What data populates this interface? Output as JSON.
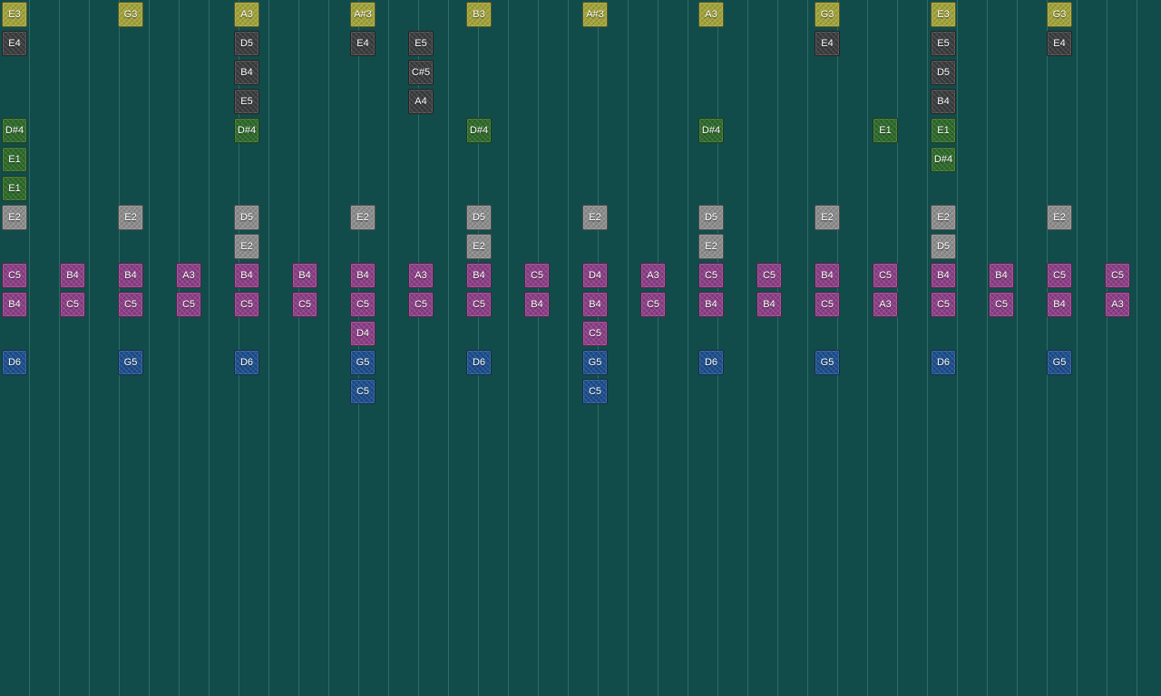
{
  "track_colors": {
    "yellow": "#a3a43a",
    "dark": "#3b3d3e",
    "green": "#2e6b2a",
    "gray": "#8e8e8e",
    "pink": "#8d3f87",
    "blue": "#1d4f8e"
  },
  "rows": [
    {
      "track": "yellow",
      "notes": [
        [
          "E3",
          0
        ],
        [
          "G3",
          4
        ],
        [
          "A3",
          8
        ],
        [
          "A#3",
          12
        ],
        [
          "B3",
          16
        ],
        [
          "A#3",
          20
        ],
        [
          "A3",
          24
        ],
        [
          "G3",
          28
        ],
        [
          "E3",
          32
        ],
        [
          "G3",
          36
        ]
      ]
    },
    {
      "track": "dark",
      "notes": [
        [
          "E4",
          0
        ],
        [
          "D5",
          8
        ],
        [
          "E4",
          12
        ],
        [
          "E5",
          14
        ],
        [
          "E4",
          28
        ],
        [
          "E5",
          32
        ],
        [
          "E4",
          36
        ]
      ]
    },
    {
      "track": "dark",
      "notes": [
        [
          "B4",
          8
        ],
        [
          "C#5",
          14
        ],
        [
          "D5",
          32
        ]
      ]
    },
    {
      "track": "dark",
      "notes": [
        [
          "E5",
          8
        ],
        [
          "A4",
          14
        ],
        [
          "B4",
          32
        ]
      ]
    },
    {
      "track": "green",
      "notes": [
        [
          "D#4",
          0
        ],
        [
          "D#4",
          8
        ],
        [
          "D#4",
          16
        ],
        [
          "D#4",
          24
        ],
        [
          "E1",
          30
        ],
        [
          "E1",
          32
        ]
      ]
    },
    {
      "track": "green",
      "notes": [
        [
          "E1",
          0
        ],
        [
          "D#4",
          32
        ]
      ]
    },
    {
      "track": "green",
      "notes": [
        [
          "E1",
          0
        ]
      ]
    },
    {
      "track": "gray",
      "notes": [
        [
          "E2",
          0
        ],
        [
          "E2",
          4
        ],
        [
          "D5",
          8
        ],
        [
          "E2",
          12
        ],
        [
          "D5",
          16
        ],
        [
          "E2",
          20
        ],
        [
          "D5",
          24
        ],
        [
          "E2",
          28
        ],
        [
          "E2",
          32
        ],
        [
          "E2",
          36
        ]
      ]
    },
    {
      "track": "gray",
      "notes": [
        [
          "E2",
          8
        ],
        [
          "E2",
          16
        ],
        [
          "E2",
          24
        ],
        [
          "D5",
          32
        ]
      ]
    },
    {
      "track": "pink",
      "notes": [
        [
          "C5",
          0
        ],
        [
          "B4",
          2
        ],
        [
          "B4",
          4
        ],
        [
          "A3",
          6
        ],
        [
          "B4",
          8
        ],
        [
          "B4",
          10
        ],
        [
          "B4",
          12
        ],
        [
          "A3",
          14
        ],
        [
          "B4",
          16
        ],
        [
          "C5",
          18
        ],
        [
          "D4",
          20
        ],
        [
          "A3",
          22
        ],
        [
          "C5",
          24
        ],
        [
          "C5",
          26
        ],
        [
          "B4",
          28
        ],
        [
          "C5",
          30
        ],
        [
          "B4",
          32
        ],
        [
          "B4",
          34
        ],
        [
          "C5",
          36
        ],
        [
          "C5",
          38
        ]
      ]
    },
    {
      "track": "pink",
      "notes": [
        [
          "B4",
          0
        ],
        [
          "C5",
          2
        ],
        [
          "C5",
          4
        ],
        [
          "C5",
          6
        ],
        [
          "C5",
          8
        ],
        [
          "C5",
          10
        ],
        [
          "C5",
          12
        ],
        [
          "C5",
          14
        ],
        [
          "C5",
          16
        ],
        [
          "B4",
          18
        ],
        [
          "B4",
          20
        ],
        [
          "C5",
          22
        ],
        [
          "B4",
          24
        ],
        [
          "B4",
          26
        ],
        [
          "C5",
          28
        ],
        [
          "A3",
          30
        ],
        [
          "C5",
          32
        ],
        [
          "C5",
          34
        ],
        [
          "B4",
          36
        ],
        [
          "A3",
          38
        ]
      ]
    },
    {
      "track": "pink",
      "notes": [
        [
          "D4",
          12
        ],
        [
          "C5",
          20
        ]
      ]
    },
    {
      "track": "blue",
      "notes": [
        [
          "D6",
          0
        ],
        [
          "G5",
          4
        ],
        [
          "D6",
          8
        ],
        [
          "G5",
          12
        ],
        [
          "D6",
          16
        ],
        [
          "G5",
          20
        ],
        [
          "D6",
          24
        ],
        [
          "G5",
          28
        ],
        [
          "D6",
          32
        ],
        [
          "G5",
          36
        ]
      ]
    },
    {
      "track": "blue",
      "notes": [
        [
          "C5",
          12
        ],
        [
          "C5",
          20
        ]
      ]
    }
  ]
}
